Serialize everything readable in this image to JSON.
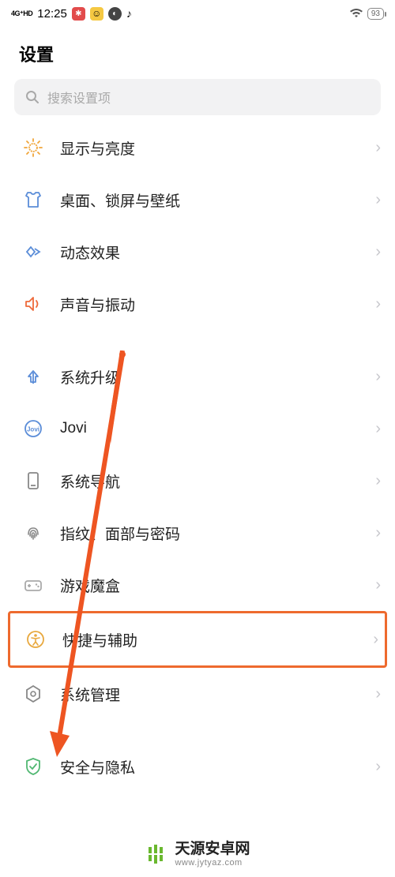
{
  "status_bar": {
    "signal": "4G⁺HD",
    "time": "12:25",
    "battery": "93"
  },
  "page": {
    "title": "设置"
  },
  "search": {
    "placeholder": "搜索设置项"
  },
  "group1": [
    {
      "id": "display",
      "label": "显示与亮度",
      "icon": "sun-icon",
      "color": "#f0a539"
    },
    {
      "id": "desktop",
      "label": "桌面、锁屏与壁纸",
      "icon": "tshirt-icon",
      "color": "#5b8dd8"
    },
    {
      "id": "animation",
      "label": "动态效果",
      "icon": "diamond-arrow-icon",
      "color": "#5b8dd8"
    },
    {
      "id": "sound",
      "label": "声音与振动",
      "icon": "speaker-icon",
      "color": "#ee6a3a"
    }
  ],
  "group2": [
    {
      "id": "upgrade",
      "label": "系统升级",
      "icon": "arrow-up-icon",
      "color": "#5b8dd8"
    },
    {
      "id": "jovi",
      "label": "Jovi",
      "icon": "jovi-icon",
      "color": "#5b8dd8"
    },
    {
      "id": "navigation",
      "label": "系统导航",
      "icon": "phone-nav-icon",
      "color": "#888"
    },
    {
      "id": "biometric",
      "label": "指纹、面部与密码",
      "icon": "fingerprint-icon",
      "color": "#888"
    },
    {
      "id": "gamebox",
      "label": "游戏魔盒",
      "icon": "gamepad-icon",
      "color": "#aaa"
    },
    {
      "id": "accessibility",
      "label": "快捷与辅助",
      "icon": "accessibility-icon",
      "color": "#e8a83e",
      "highlighted": true
    },
    {
      "id": "sysmgmt",
      "label": "系统管理",
      "icon": "hex-gear-icon",
      "color": "#888"
    }
  ],
  "group3": [
    {
      "id": "security",
      "label": "安全与隐私",
      "icon": "shield-check-icon",
      "color": "#52b873"
    }
  ],
  "watermark": {
    "title": "天源安卓网",
    "url": "www.jytyaz.com"
  }
}
